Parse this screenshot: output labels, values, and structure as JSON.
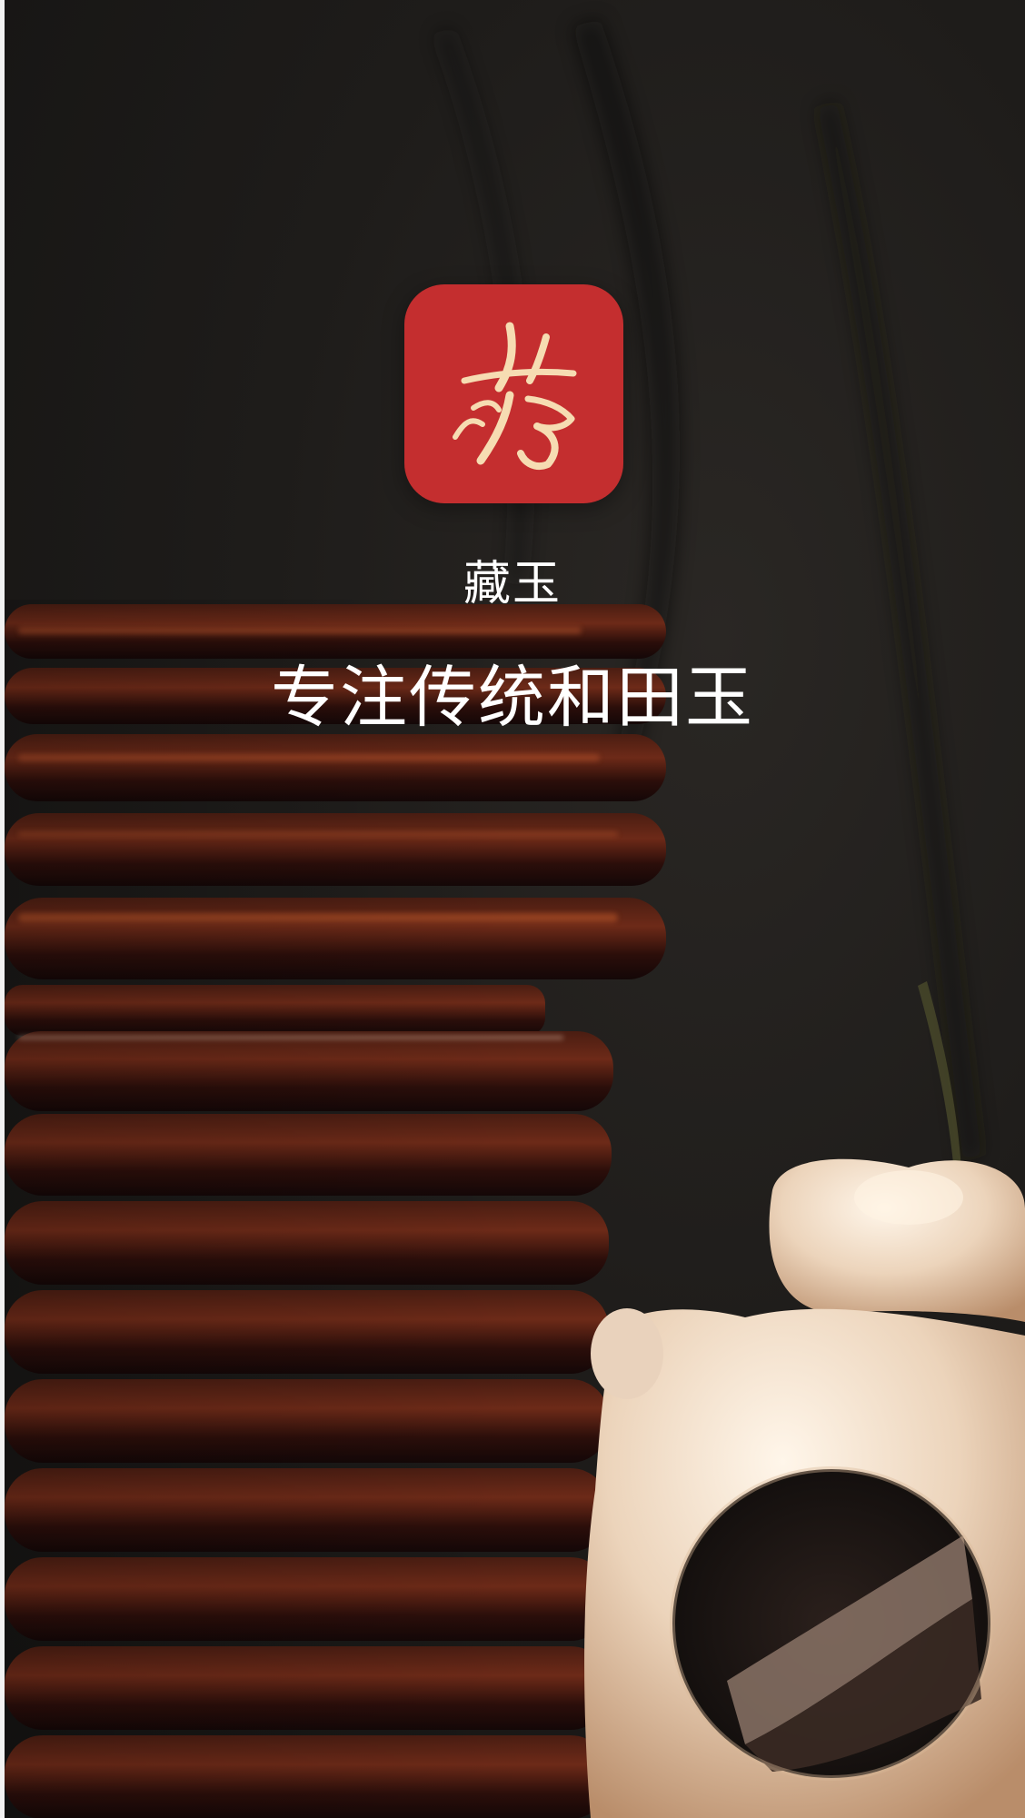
{
  "splash": {
    "logo_icon": "calligraphy-logo-icon",
    "app_name": "藏玉",
    "tagline": "专注传统和田玉",
    "logo_color": "#c42e2f",
    "logo_glyph_color": "#f6dcb2",
    "background_color": "#1d1b19"
  }
}
